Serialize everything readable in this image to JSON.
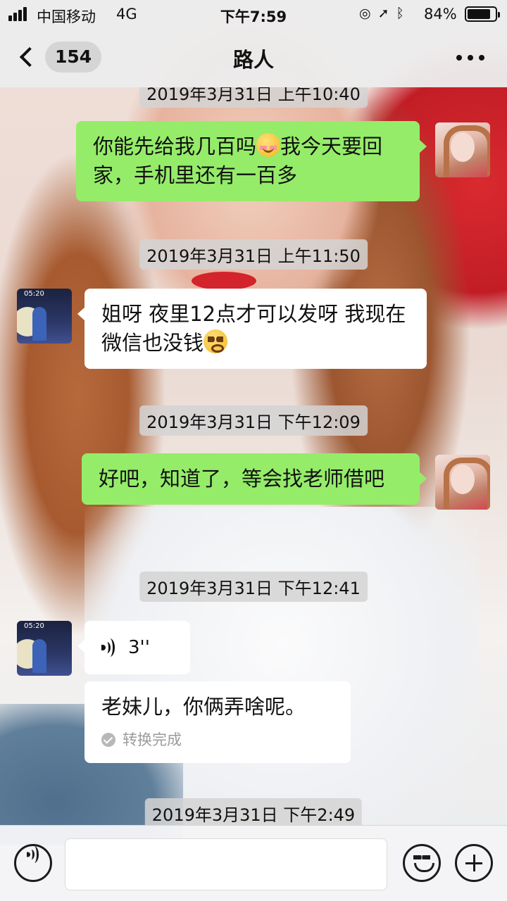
{
  "status_bar": {
    "carrier": "中国移动",
    "network": "4G",
    "time": "下午7:59",
    "battery_percent": "84%",
    "battery_level": 0.84
  },
  "nav": {
    "unread_count": "154",
    "title": "路人"
  },
  "messages": {
    "ts0": "2019年3月31日 上午10:40",
    "m1_part1": "你能先给我几百吗",
    "m1_part2": "我今天要回家，手机里还有一百多",
    "ts1": "2019年3月31日 上午11:50",
    "m2": "姐呀  夜里12点才可以发呀   我现在微信也没钱",
    "ts2": "2019年3月31日 下午12:09",
    "m3": "好吧，知道了，等会找老师借吧",
    "ts3": "2019年3月31日 下午12:41",
    "voice_duration": "3''",
    "voice_transcript": "老妹儿，你俩弄啥呢。",
    "transcript_status": "转换完成",
    "ts4": "2019年3月31日 下午2:49",
    "other_avatar_time": "05:20"
  },
  "colors": {
    "sent_bubble": "#95ec69",
    "received_bubble": "#ffffff",
    "bar_bg": "#ececec"
  },
  "icons": [
    "back-chevron-icon",
    "more-icon",
    "voice-icon",
    "emoji-icon",
    "plus-icon",
    "check-icon",
    "signal-icon",
    "battery-icon"
  ]
}
